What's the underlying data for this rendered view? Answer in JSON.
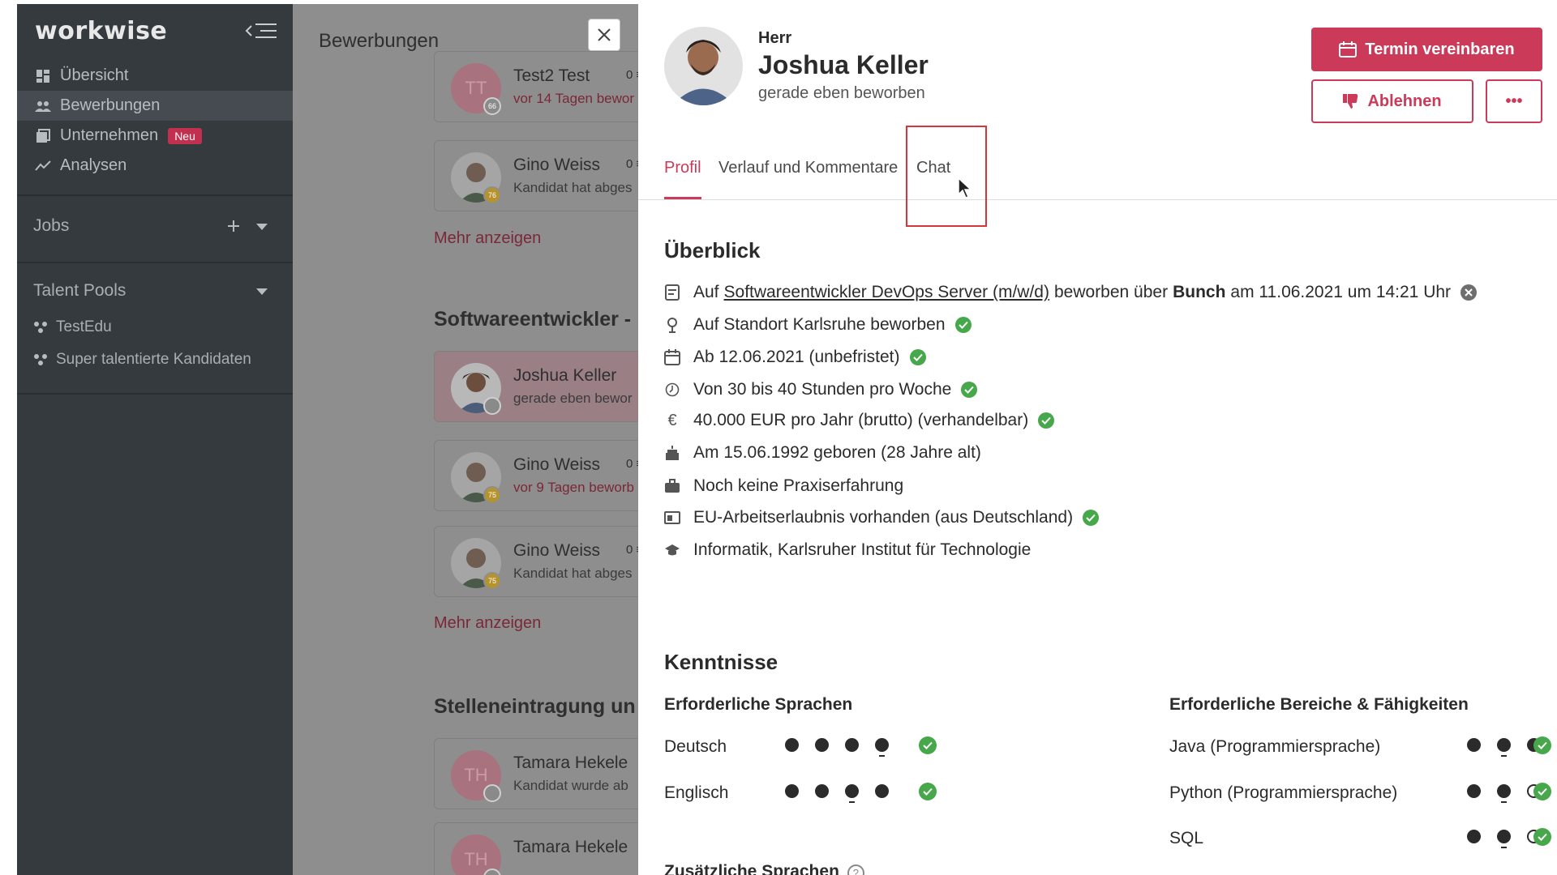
{
  "sidebar": {
    "logo": "workwise",
    "nav": [
      {
        "label": "Übersicht",
        "icon": "dashboard-icon"
      },
      {
        "label": "Bewerbungen",
        "icon": "people-icon",
        "active": true
      },
      {
        "label": "Unternehmen",
        "icon": "company-icon",
        "badge": "Neu"
      },
      {
        "label": "Analysen",
        "icon": "analytics-icon"
      }
    ],
    "jobs_title": "Jobs",
    "talent_pools_title": "Talent Pools",
    "pools": [
      "TestEdu",
      "Super talentierte Kandidaten"
    ]
  },
  "middle": {
    "title": "Bewerbungen",
    "cards_top": [
      {
        "name": "Test2 Test",
        "count": "0",
        "sub": "vor 14 Tagen bewor",
        "initials": "TT",
        "score": "66",
        "sub_red": true
      },
      {
        "name": "Gino Weiss",
        "count": "0",
        "sub": "Kandidat hat abges",
        "score": "76"
      }
    ],
    "more_label": "Mehr anzeigen",
    "section_title": "Softwareentwickler -",
    "cards_mid": [
      {
        "name": "Joshua Keller",
        "count": "0",
        "sub": "gerade eben bewor",
        "selected": true
      },
      {
        "name": "Gino Weiss",
        "count": "0",
        "sub": "vor 9 Tagen beworb",
        "score": "75",
        "sub_red": true
      },
      {
        "name": "Gino Weiss",
        "count": "0",
        "sub": "Kandidat hat abges",
        "score": "75"
      }
    ],
    "more_label_2": "Mehr anzeigen",
    "section_title_2": "Stelleneintragung un",
    "cards_bottom": [
      {
        "name": "Tamara Hekele",
        "sub": "Kandidat wurde ab",
        "initials": "TH"
      },
      {
        "name": "Tamara Hekele",
        "sub": "",
        "initials": "TH"
      }
    ]
  },
  "candidate": {
    "salutation": "Herr",
    "name": "Joshua Keller",
    "status": "gerade eben beworben",
    "btn_schedule": "Termin vereinbaren",
    "btn_reject": "Ablehnen",
    "btn_more": "•••"
  },
  "tabs": [
    "Profil",
    "Verlauf und Kommentare",
    "Chat"
  ],
  "overview": {
    "title": "Überblick",
    "applied_prefix": "Auf",
    "job_link": "Softwareentwickler DevOps Server (m/w/d)",
    "applied_via": "beworben über",
    "source": "Bunch",
    "applied_date": "am 11.06.2021 um 14:21 Uhr",
    "rows": [
      {
        "text": "Auf Standort Karlsruhe beworben",
        "icon": "location-icon",
        "check": true
      },
      {
        "text": "Ab 12.06.2021 (unbefristet)",
        "icon": "calendar-icon",
        "check": true
      },
      {
        "text": "Von 30 bis 40 Stunden pro Woche",
        "icon": "clock-icon",
        "check": true
      },
      {
        "text": "40.000 EUR pro Jahr (brutto) (verhandelbar)",
        "icon": "euro-icon",
        "check": true
      },
      {
        "text": "Am 15.06.1992 geboren (28 Jahre alt)",
        "icon": "cake-icon",
        "check": false
      },
      {
        "text": "Noch keine Praxiserfahrung",
        "icon": "briefcase-icon",
        "check": false
      },
      {
        "text": "EU-Arbeitserlaubnis vorhanden (aus Deutschland)",
        "icon": "id-card-icon",
        "check": true
      },
      {
        "text": "Informatik, Karlsruher Institut für Technologie",
        "icon": "graduation-icon",
        "check": false
      }
    ]
  },
  "skills": {
    "title": "Kenntnisse",
    "languages_title": "Erforderliche Sprachen",
    "languages": [
      {
        "name": "Deutsch",
        "level": 4,
        "marker": 4
      },
      {
        "name": "Englisch",
        "level": 4,
        "marker": 3
      }
    ],
    "areas_title": "Erforderliche Bereiche & Fähigkeiten",
    "areas": [
      {
        "name": "Java (Programmiersprache)",
        "level": 3,
        "marker": 2
      },
      {
        "name": "Python (Programmiersprache)",
        "level": 2,
        "marker": 2
      },
      {
        "name": "SQL",
        "level": 2,
        "marker": 2
      }
    ],
    "additional_title": "Zusätzliche Sprachen",
    "help": "?"
  },
  "colors": {
    "brand": "#cc3a59",
    "check": "#46a84a",
    "sidebar": "#353a3f"
  }
}
